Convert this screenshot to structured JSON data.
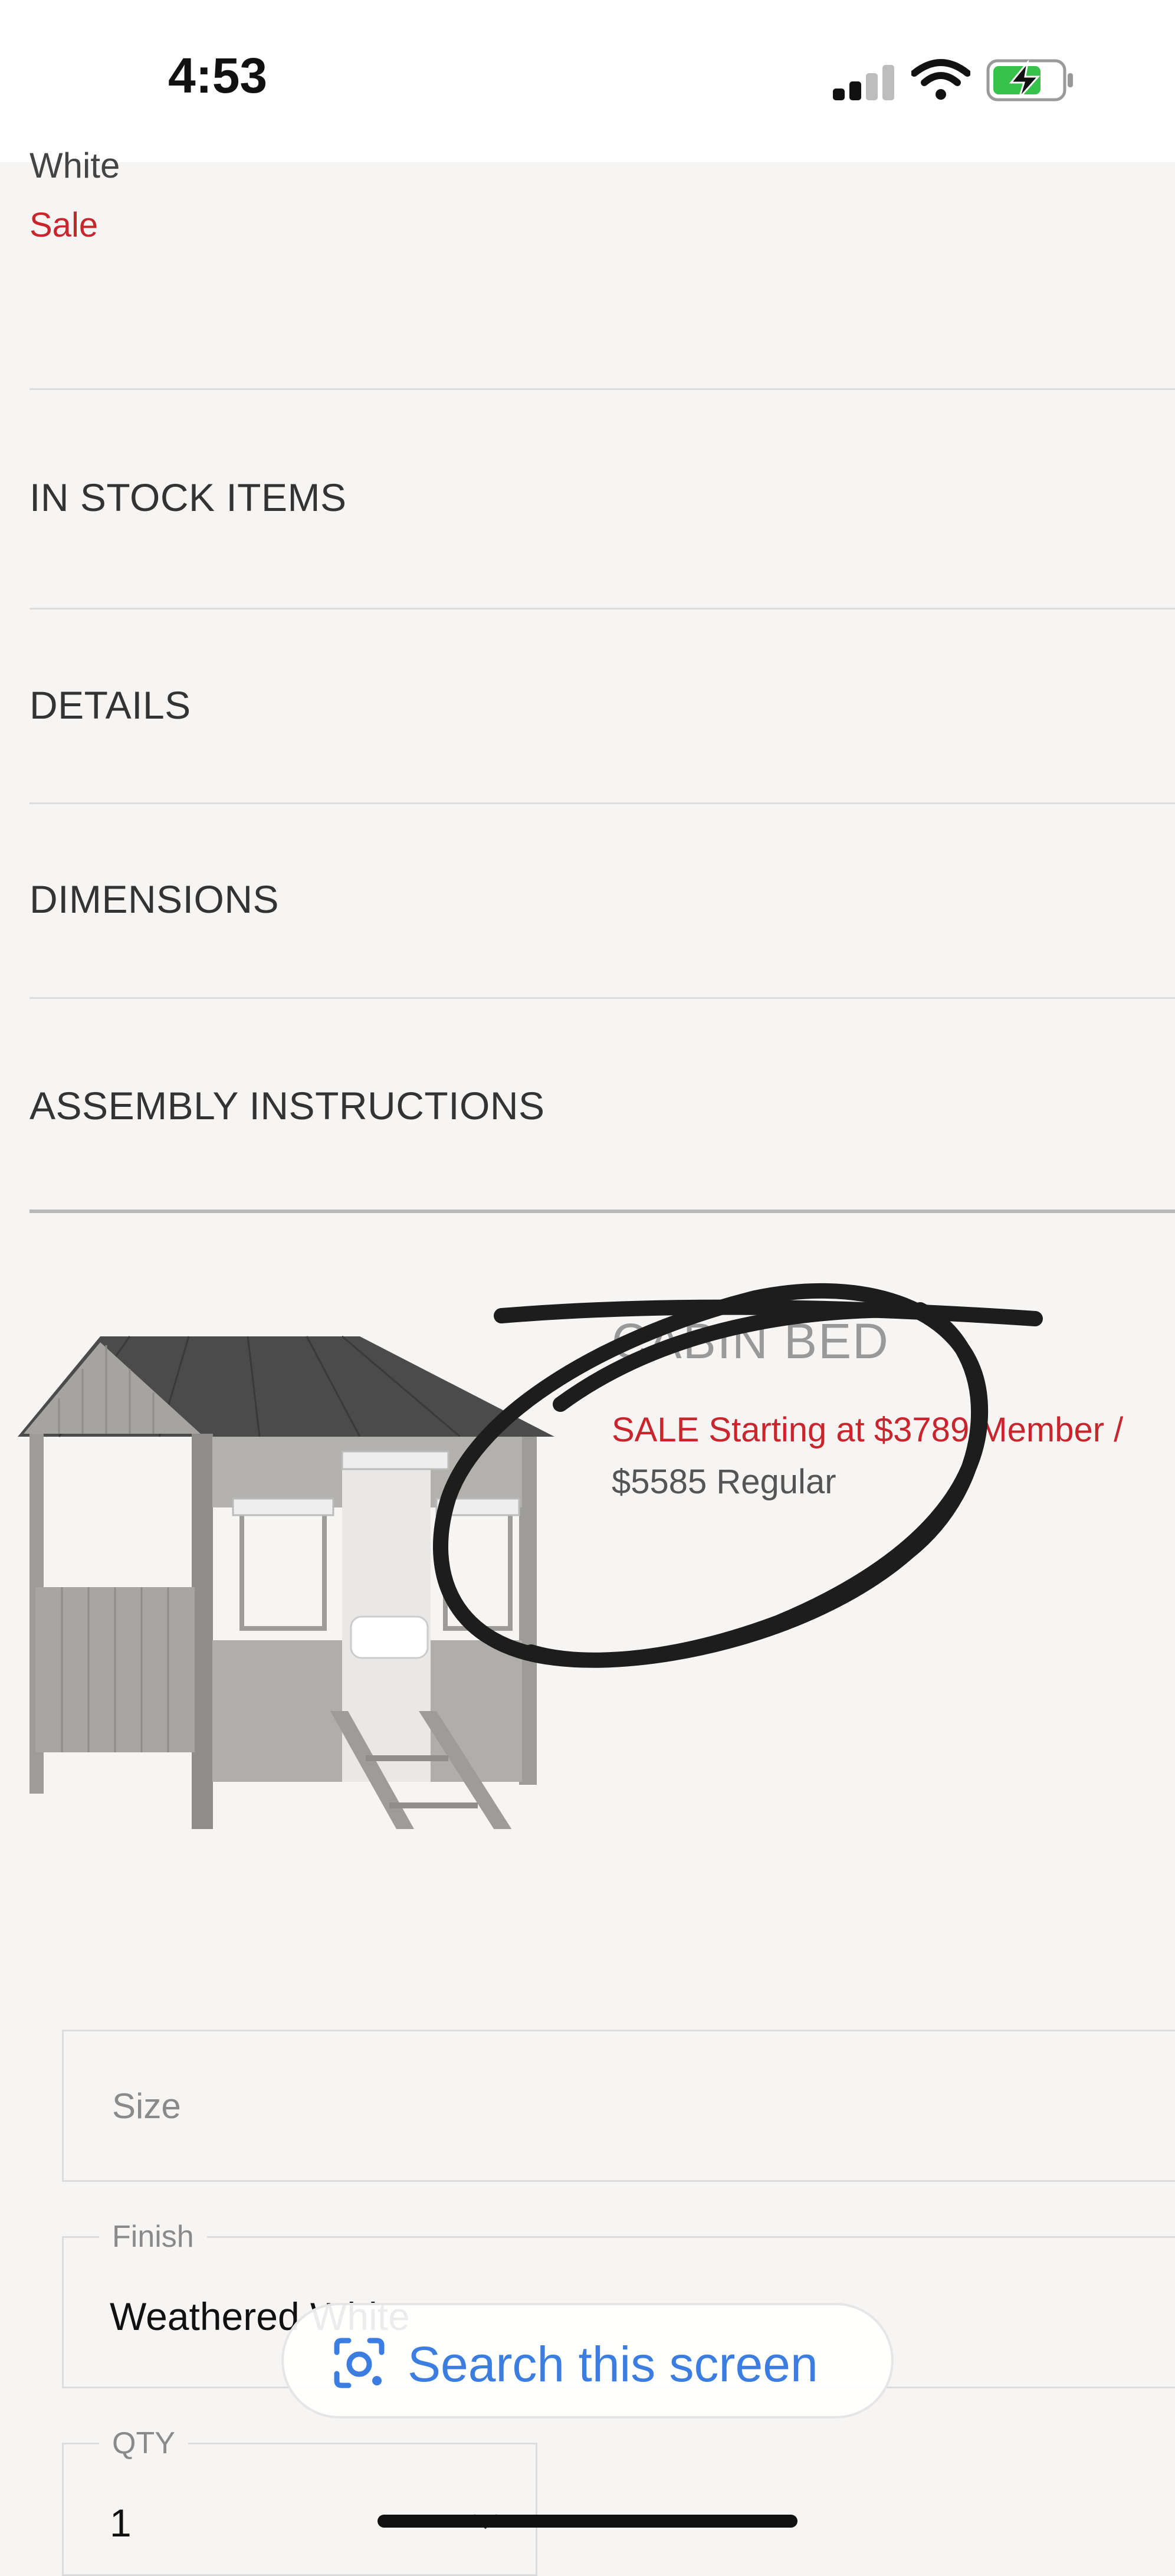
{
  "status_bar": {
    "time": "4:53"
  },
  "top": {
    "cut_text": "White",
    "sale_label": "Sale"
  },
  "accordion": [
    {
      "label": "IN STOCK ITEMS"
    },
    {
      "label": "DETAILS"
    },
    {
      "label": "DIMENSIONS"
    },
    {
      "label": "ASSEMBLY INSTRUCTIONS"
    }
  ],
  "product": {
    "name": "CABIN BED",
    "sale_text": "SALE Starting at $3789 Member /",
    "regular_text": "$5585 Regular"
  },
  "options": {
    "size_placeholder": "Size",
    "finish_label": "Finish",
    "finish_value": "Weathered White",
    "qty_label": "QTY",
    "qty_value": "1"
  },
  "overlay": {
    "search_label": "Search this screen"
  },
  "colors": {
    "sale_red": "#c9252c",
    "search_blue": "#3b7de0",
    "background": "#f6f5f3",
    "battery_green": "#36c24a"
  }
}
